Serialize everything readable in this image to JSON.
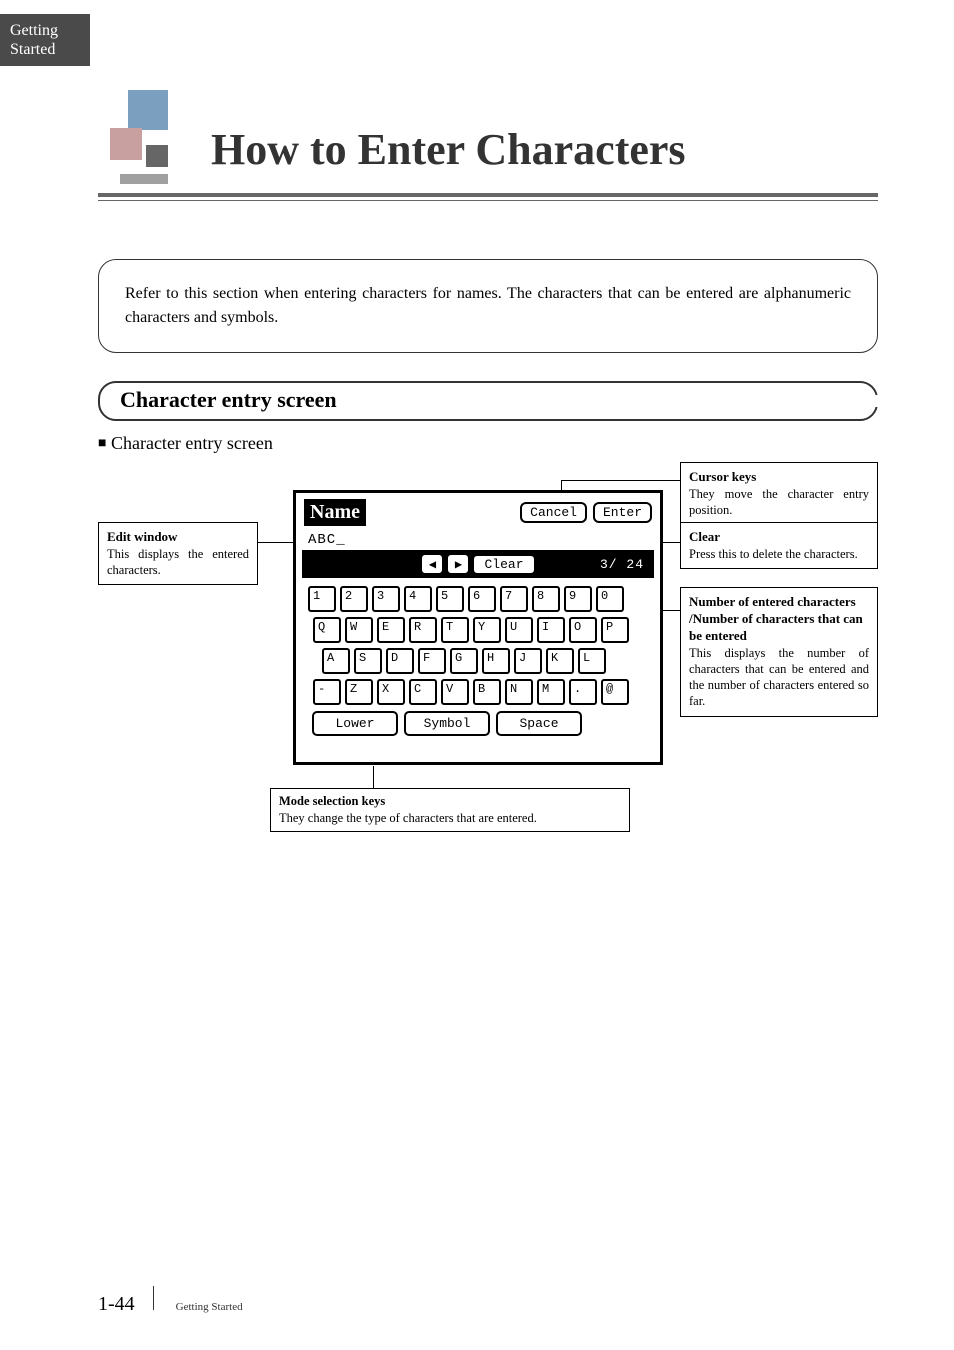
{
  "tab": {
    "line1": "Getting",
    "line2": "Started"
  },
  "title": "How to Enter Characters",
  "intro": "Refer to this section when entering characters for names. The characters that can be entered are alphanumeric characters and symbols.",
  "section_header": "Character entry screen",
  "subhead_marker": "■",
  "subhead": "Character entry screen",
  "callouts": {
    "edit_window": {
      "title": "Edit window",
      "desc": "This displays the entered characters."
    },
    "cursor_keys": {
      "title": "Cursor keys",
      "desc": "They move the character entry position."
    },
    "clear": {
      "title": "Clear",
      "desc": "Press this to delete the characters."
    },
    "count": {
      "title": "Number of entered characters /Number of characters that can be entered",
      "desc": "This displays the number of characters that can be entered and the number of characters entered so far."
    },
    "mode": {
      "title": "Mode selection keys",
      "desc": "They change the type of characters that are entered."
    }
  },
  "screen": {
    "title": "Name",
    "cancel": "Cancel",
    "enter": "Enter",
    "field_value": "ABC_",
    "arrow_left": "◀",
    "arrow_right": "▶",
    "clear_btn": "Clear",
    "count": "3/ 24",
    "keys_row1": [
      "1",
      "2",
      "3",
      "4",
      "5",
      "6",
      "7",
      "8",
      "9",
      "0"
    ],
    "keys_row2": [
      "Q",
      "W",
      "E",
      "R",
      "T",
      "Y",
      "U",
      "I",
      "O",
      "P"
    ],
    "keys_row3": [
      "A",
      "S",
      "D",
      "F",
      "G",
      "H",
      "J",
      "K",
      "L"
    ],
    "keys_row4": [
      "-",
      "Z",
      "X",
      "C",
      "V",
      "B",
      "N",
      "M",
      ".",
      "@"
    ],
    "mode_lower": "Lower",
    "mode_symbol": "Symbol",
    "mode_space": "Space"
  },
  "footer": {
    "page": "1-44",
    "section": "Getting Started"
  }
}
